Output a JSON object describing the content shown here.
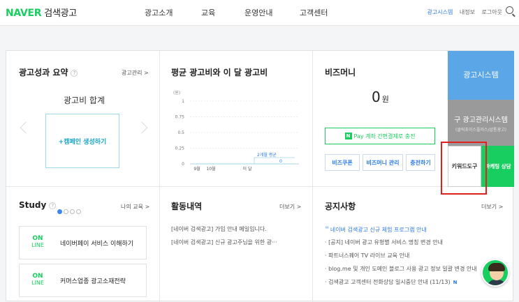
{
  "header": {
    "logo": "NAVER",
    "logo_sub": "검색광고",
    "nav": [
      "광고소개",
      "교육",
      "운영안내",
      "고객센터"
    ],
    "util": {
      "ad_system": "광고시스템",
      "my_info": "내정보",
      "logout": "로그아웃"
    }
  },
  "perf": {
    "title": "광고성과 요약",
    "help": "?",
    "more": "광고관리 >",
    "sum_label": "광고비 합계",
    "create_campaign": "+캠페인 생성하기"
  },
  "avg": {
    "title": "평균 광고비와 이 달 광고비",
    "unit": "(원)",
    "y_ticks": [
      "1",
      "0.75",
      "0.5",
      "0.25",
      "0"
    ],
    "x_ticks": [
      "9월",
      "10월",
      "이 달"
    ],
    "annotation": "2개월 평균",
    "annotation_value": "0"
  },
  "chart_data": {
    "type": "bar",
    "title": "평균 광고비와 이 달 광고비",
    "ylabel": "(원)",
    "categories": [
      "9월",
      "10월",
      "이 달"
    ],
    "values": [
      0,
      0,
      0
    ],
    "ylim": [
      0,
      1
    ],
    "annotations": [
      {
        "label": "2개월 평균",
        "value": 0
      }
    ]
  },
  "bizmoney": {
    "title": "비즈머니",
    "amount": "0",
    "unit": "원",
    "npay_badge": "N",
    "npay_text": "Pay 계좌 간편결제로 충전",
    "buttons": [
      "비즈쿠폰",
      "비즈머니 관리",
      "충전하기"
    ]
  },
  "side": {
    "ad_system": "광고시스템",
    "old_system": "구 광고관리시스템",
    "old_system_sub": "(클릭초이스플러스/샵통광고)",
    "keyword_tool": "키워드도구",
    "marketing": "마케팅 상담"
  },
  "study": {
    "title": "Study",
    "more": "나의 교육 >",
    "cards": [
      {
        "on": "ON",
        "line": "LINE",
        "text": "네이버페이 서비스 이해하기"
      },
      {
        "on": "ON",
        "line": "LINE",
        "text": "커머스업종 광고소재전략"
      }
    ]
  },
  "activity": {
    "title": "활동내역",
    "more": "더보기 >",
    "items": [
      "[네이버 검색광고] 가입 안내 메일입니다.",
      "[네이버 검색광고] 신규 광고주님을 위한 광···"
    ]
  },
  "notice": {
    "title": "공지사항",
    "more": "더보기 >",
    "items": [
      "네이버 검색광고 신규 체험 프로그램 안내",
      "[공지] 네이버 광고 유형별 서비스 명칭 변경 안내",
      "파트너스퀘어 TV 라이브 교육 안내",
      "blog.me 및 개인 도메인 블로그 사용 광고 정보 일괄 변경 안내",
      "검색광고 고객센터 전화상담 일시중단 안내 (11/13)"
    ],
    "new_badge": "N"
  },
  "colors": {
    "naver_green": "#19ce60",
    "blue": "#5ba6e6",
    "gray": "#9a9a9a",
    "highlight_red": "#e32020"
  }
}
